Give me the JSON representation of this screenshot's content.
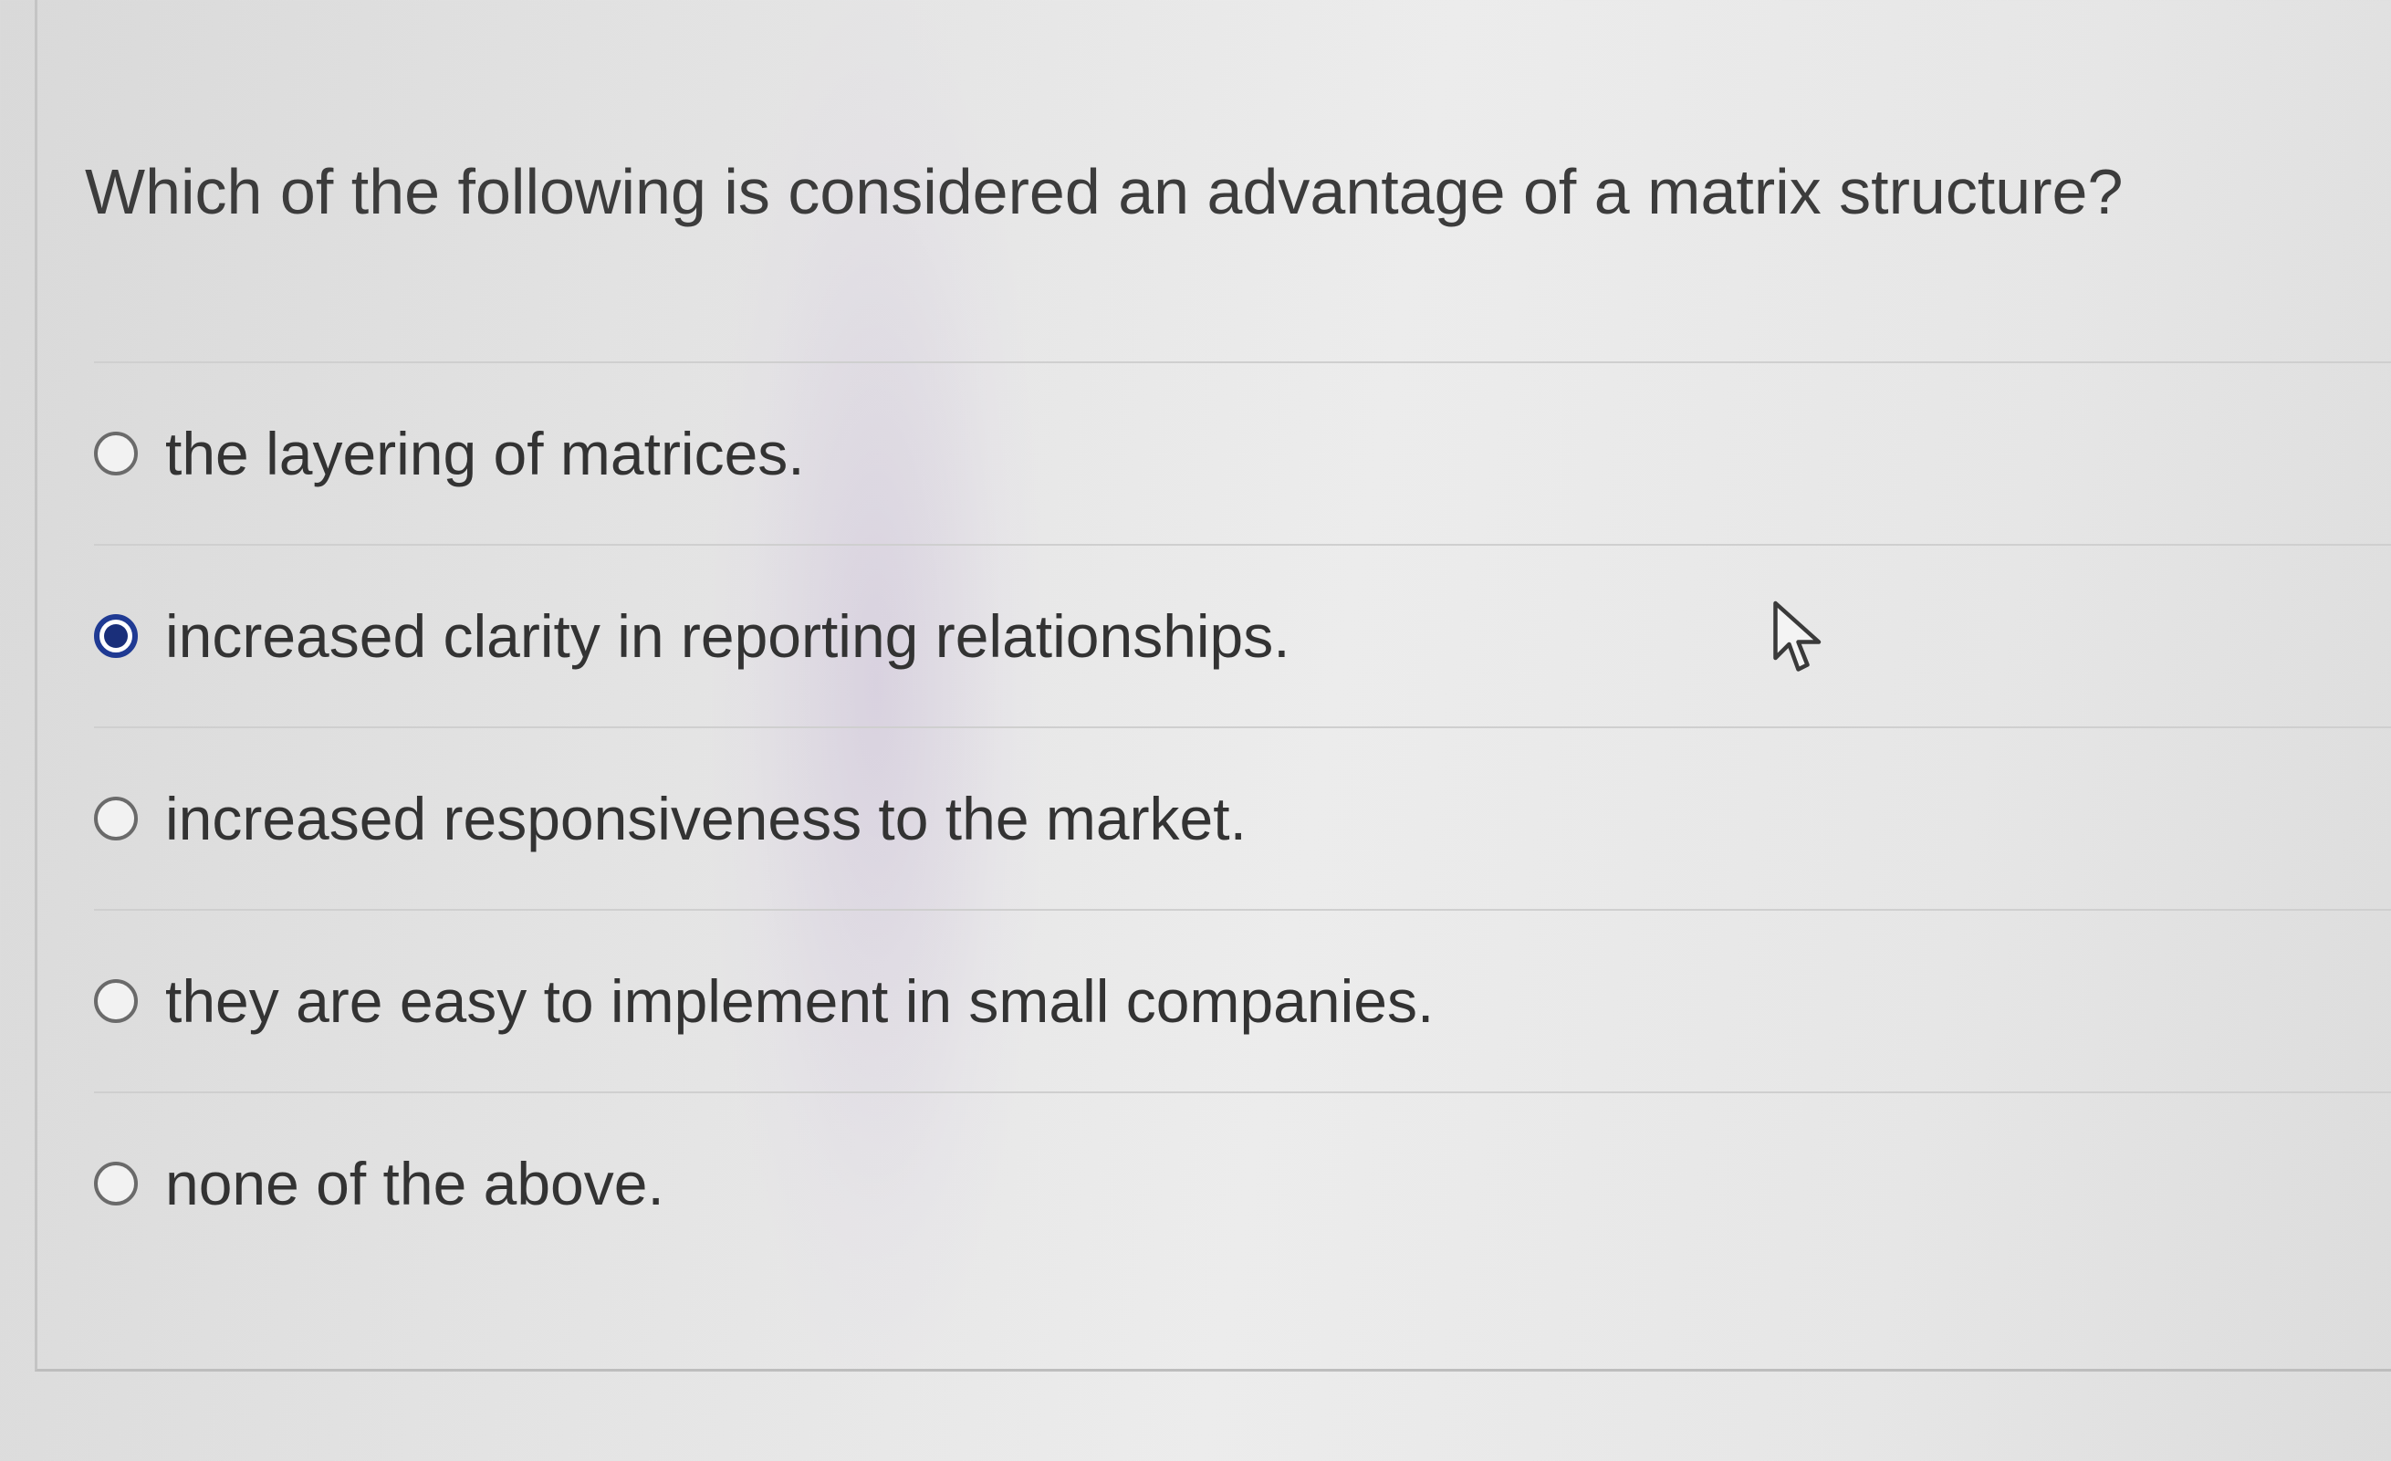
{
  "question": {
    "text": "Which of the following is considered an advantage of a matrix structure?"
  },
  "options": [
    {
      "label": "the layering of matrices.",
      "selected": false
    },
    {
      "label": "increased clarity in reporting relationships.",
      "selected": true
    },
    {
      "label": "increased responsiveness to the market.",
      "selected": false
    },
    {
      "label": "they are easy to implement in small companies.",
      "selected": false
    },
    {
      "label": "none of the above.",
      "selected": false
    }
  ],
  "colors": {
    "selected_radio": "#1a2f7a",
    "background": "#e6e6e6",
    "text": "#333333"
  },
  "icons": {
    "cursor": "mouse-pointer-icon",
    "radio": "radio-button-icon"
  }
}
